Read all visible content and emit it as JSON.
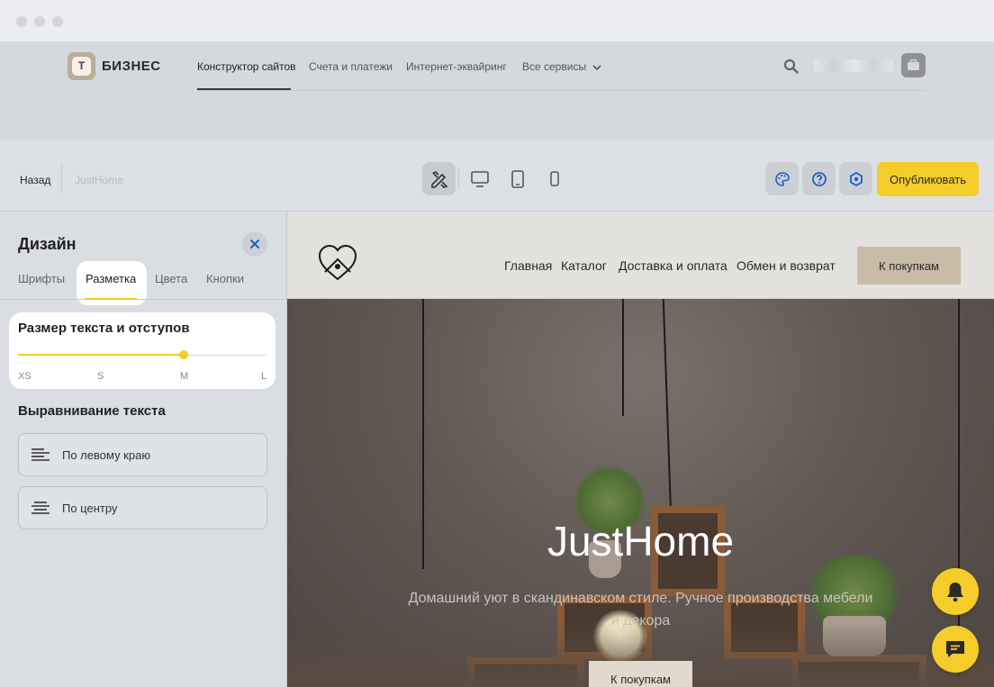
{
  "brand": {
    "logo_letter": "Т",
    "name": "БИЗНЕС"
  },
  "top_nav": {
    "items": [
      {
        "label": "Конструктор сайтов",
        "active": true
      },
      {
        "label": "Счета и платежи"
      },
      {
        "label": "Интернет-эквайринг"
      },
      {
        "label": "Все сервисы"
      }
    ]
  },
  "toolbar": {
    "back_label": "Назад",
    "site_name": "JustHome",
    "publish_label": "Опубликовать",
    "view_modes": [
      "edit-icon",
      "desktop-icon",
      "tablet-icon",
      "mobile-icon"
    ],
    "side_buttons": [
      "palette-icon",
      "help-icon",
      "settings-icon"
    ]
  },
  "panel": {
    "title": "Дизайн",
    "tabs": [
      {
        "label": "Шрифты"
      },
      {
        "label": "Разметка",
        "active": true
      },
      {
        "label": "Цвета"
      },
      {
        "label": "Кнопки"
      }
    ],
    "size_card": {
      "title": "Размер текста и отступов",
      "scale": [
        "XS",
        "S",
        "M",
        "L"
      ],
      "selected": "M"
    },
    "alignment": {
      "title": "Выравнивание текста",
      "options": [
        {
          "label": "По левому краю"
        },
        {
          "label": "По центру"
        }
      ]
    }
  },
  "preview": {
    "nav": [
      "Главная",
      "Каталог",
      "Доставка и оплата",
      "Обмен и возврат"
    ],
    "header_cta": "К покупкам",
    "hero_title": "JustHome",
    "hero_subtitle": "Домашний уют в скандинавском стиле. Ручное производства мебели и декора",
    "hero_cta": "К покупкам"
  },
  "colors": {
    "accent": "#f5cd2a",
    "publish": "#f5cd2a",
    "cta_beige": "#c8bca8"
  },
  "floating": [
    "bell-icon",
    "chat-icon"
  ]
}
